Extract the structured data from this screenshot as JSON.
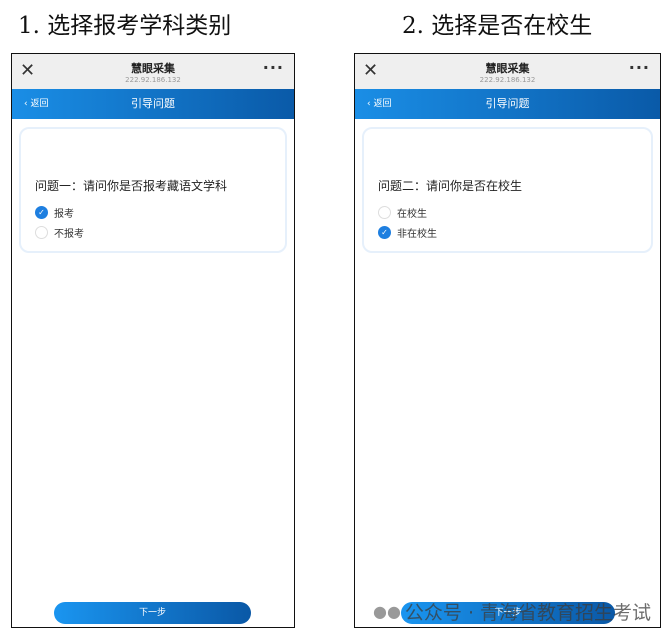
{
  "captions": [
    "1. 选择报考学科类别",
    "2. 选择是否在校生"
  ],
  "app": {
    "title": "慧眼采集",
    "ip": "222.92.186.132",
    "close": "✕",
    "more": "···",
    "back": "返回",
    "nav_title": "引导问题",
    "next": "下一步"
  },
  "screens": [
    {
      "question": "问题一：请问你是否报考藏语文学科",
      "options": [
        {
          "label": "报考",
          "checked": true
        },
        {
          "label": "不报考",
          "checked": false
        }
      ]
    },
    {
      "question": "问题二：请问你是否在校生",
      "options": [
        {
          "label": "在校生",
          "checked": false
        },
        {
          "label": "非在校生",
          "checked": true
        }
      ]
    }
  ],
  "watermark": "公众号 · 青海省教育招生考试",
  "colors": {
    "accent": "#1e7fe0"
  }
}
